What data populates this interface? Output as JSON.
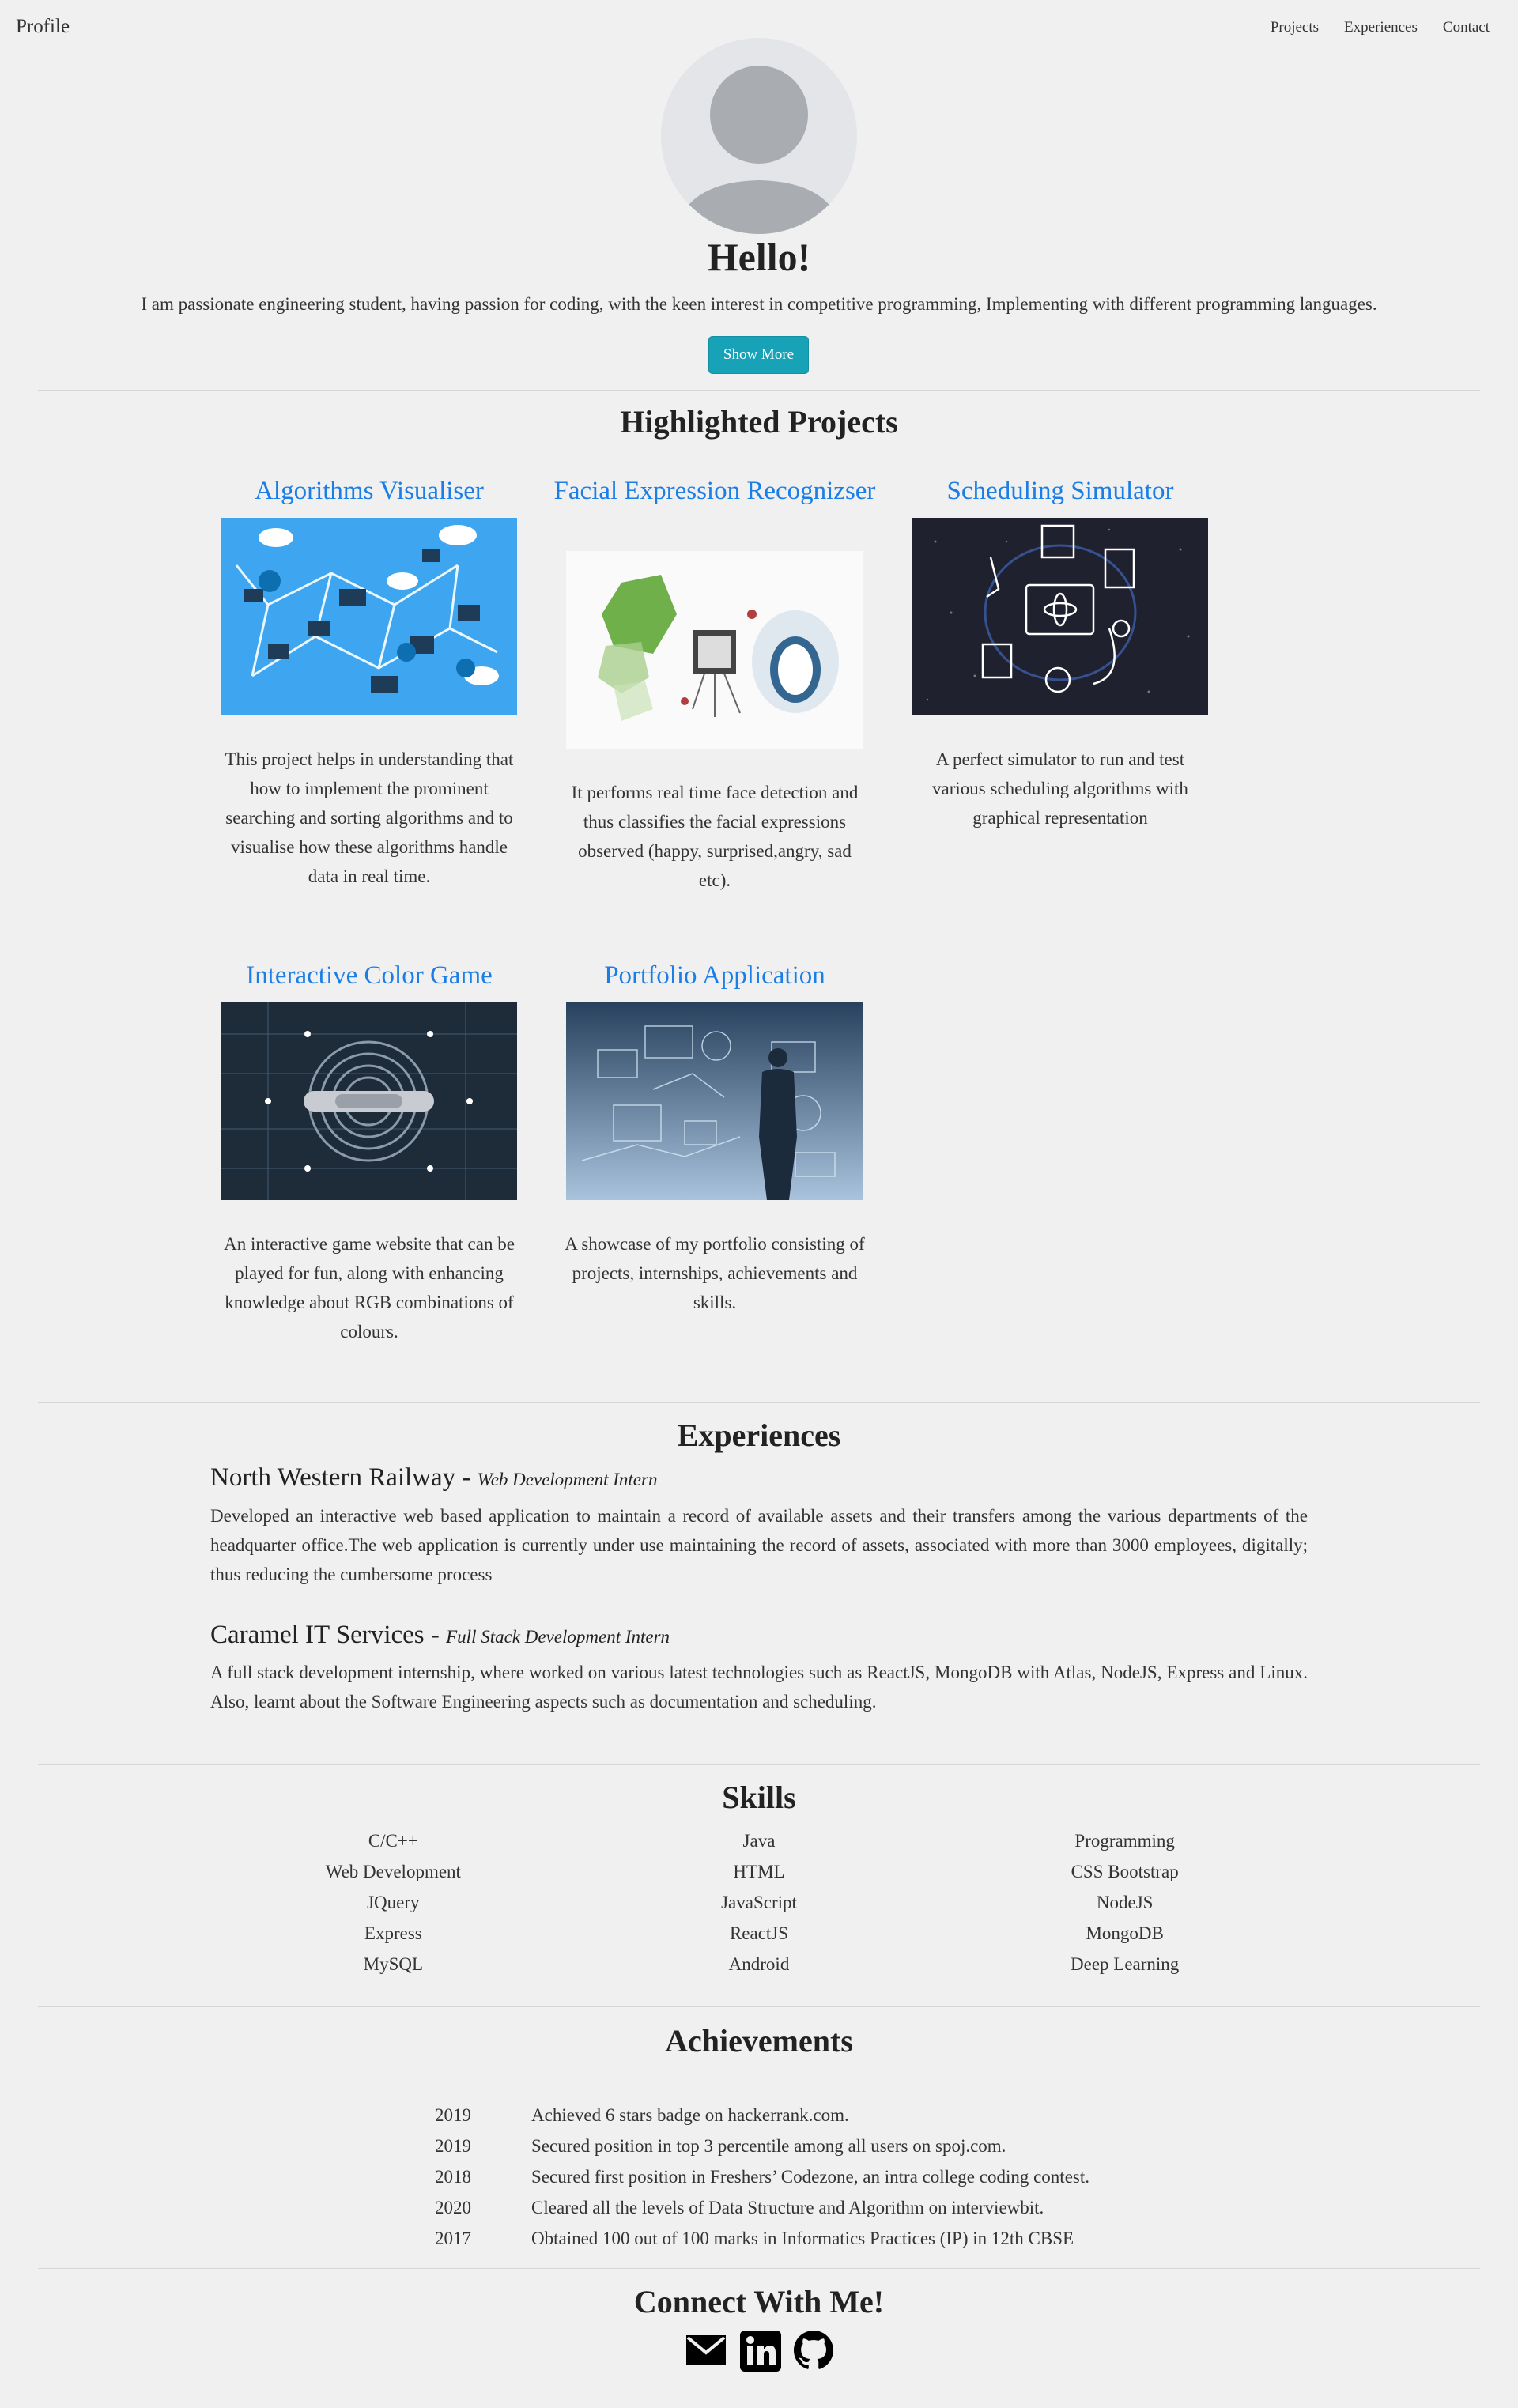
{
  "nav": {
    "brand": "Profile",
    "links": [
      "Projects",
      "Experiences",
      "Contact"
    ]
  },
  "hero": {
    "greeting": "Hello!",
    "intro": "I am passionate engineering student, having passion for coding, with the keen interest in competitive programming, Implementing with different programming languages.",
    "button": "Show More"
  },
  "projects": {
    "title": "Highlighted Projects",
    "items": [
      {
        "title": "Algorithms Visualiser",
        "description": "This project helps in understanding that how to implement the prominent searching and sorting algorithms and to visualise how these algorithms handle data in real time."
      },
      {
        "title": "Facial Expression Recognizser",
        "description": "It performs real time face detection and thus classifies the facial expressions observed (happy, surprised,angry, sad etc)."
      },
      {
        "title": "Scheduling Simulator",
        "description": "A perfect simulator to run and test various scheduling algorithms with graphical representation"
      },
      {
        "title": "Interactive Color Game",
        "description": "An interactive game website that can be played for fun, along with enhancing knowledge about RGB combinations of colours."
      },
      {
        "title": "Portfolio Application",
        "description": "A showcase of my portfolio consisting of projects, internships, achievements and skills."
      }
    ]
  },
  "experiences": {
    "title": "Experiences",
    "items": [
      {
        "company": "North Western Railway",
        "role": "Web Development Intern",
        "description": "Developed an interactive web based application to maintain a record of available assets and their transfers among the various departments of the headquarter office.The web application is currently under use maintaining the record of assets, associated with more than 3000 employees, digitally; thus reducing the cumbersome process"
      },
      {
        "company": "Caramel IT Services",
        "role": "Full Stack Development Intern",
        "description": "A full stack development internship, where worked on various latest technologies such as ReactJS, MongoDB with Atlas, NodeJS, Express and Linux. Also, learnt about the Software Engineering aspects such as documentation and scheduling."
      }
    ]
  },
  "skills": {
    "title": "Skills",
    "items": [
      "C/C++",
      "Java",
      "Programming",
      "Web Development",
      "HTML",
      "CSS Bootstrap",
      "JQuery",
      "JavaScript",
      "NodeJS",
      "Express",
      "ReactJS",
      "MongoDB",
      "MySQL",
      "Android",
      "Deep Learning"
    ]
  },
  "achievements": {
    "title": "Achievements",
    "items": [
      {
        "year": "2019",
        "text": "Achieved 6 stars badge on hackerrank.com."
      },
      {
        "year": "2019",
        "text": "Secured position in top 3 percentile among all users on spoj.com."
      },
      {
        "year": "2018",
        "text": "Secured first position in Freshers’ Codezone, an intra college coding contest."
      },
      {
        "year": "2020",
        "text": "Cleared all the levels of Data Structure and Algorithm on interviewbit."
      },
      {
        "year": "2017",
        "text": "Obtained 100 out of 100 marks in Informatics Practices (IP) in 12th CBSE"
      }
    ]
  },
  "contact": {
    "title": "Connect With Me!",
    "icons": [
      "mail-icon",
      "linkedin-icon",
      "github-icon"
    ]
  },
  "colors": {
    "background": "#f0f0f0",
    "link": "#1a7ee6",
    "button": "#17a2b8"
  }
}
